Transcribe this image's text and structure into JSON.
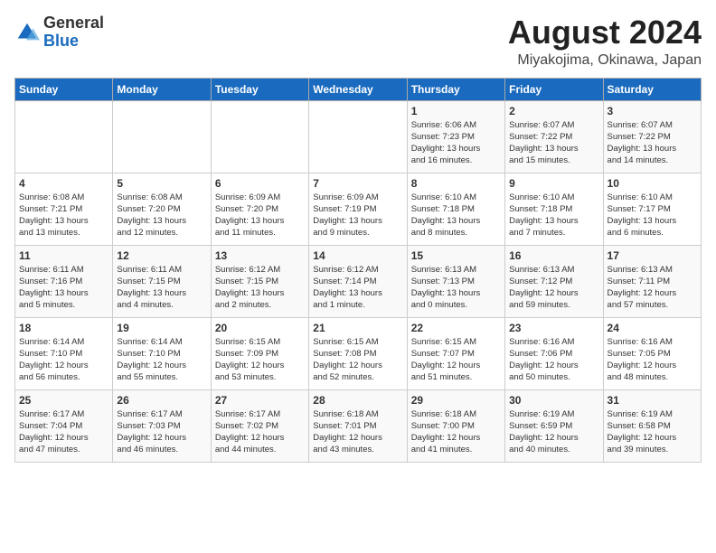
{
  "logo": {
    "general": "General",
    "blue": "Blue"
  },
  "title": "August 2024",
  "subtitle": "Miyakojima, Okinawa, Japan",
  "days_of_week": [
    "Sunday",
    "Monday",
    "Tuesday",
    "Wednesday",
    "Thursday",
    "Friday",
    "Saturday"
  ],
  "weeks": [
    [
      {
        "day": "",
        "details": ""
      },
      {
        "day": "",
        "details": ""
      },
      {
        "day": "",
        "details": ""
      },
      {
        "day": "",
        "details": ""
      },
      {
        "day": "1",
        "details": "Sunrise: 6:06 AM\nSunset: 7:23 PM\nDaylight: 13 hours\nand 16 minutes."
      },
      {
        "day": "2",
        "details": "Sunrise: 6:07 AM\nSunset: 7:22 PM\nDaylight: 13 hours\nand 15 minutes."
      },
      {
        "day": "3",
        "details": "Sunrise: 6:07 AM\nSunset: 7:22 PM\nDaylight: 13 hours\nand 14 minutes."
      }
    ],
    [
      {
        "day": "4",
        "details": "Sunrise: 6:08 AM\nSunset: 7:21 PM\nDaylight: 13 hours\nand 13 minutes."
      },
      {
        "day": "5",
        "details": "Sunrise: 6:08 AM\nSunset: 7:20 PM\nDaylight: 13 hours\nand 12 minutes."
      },
      {
        "day": "6",
        "details": "Sunrise: 6:09 AM\nSunset: 7:20 PM\nDaylight: 13 hours\nand 11 minutes."
      },
      {
        "day": "7",
        "details": "Sunrise: 6:09 AM\nSunset: 7:19 PM\nDaylight: 13 hours\nand 9 minutes."
      },
      {
        "day": "8",
        "details": "Sunrise: 6:10 AM\nSunset: 7:18 PM\nDaylight: 13 hours\nand 8 minutes."
      },
      {
        "day": "9",
        "details": "Sunrise: 6:10 AM\nSunset: 7:18 PM\nDaylight: 13 hours\nand 7 minutes."
      },
      {
        "day": "10",
        "details": "Sunrise: 6:10 AM\nSunset: 7:17 PM\nDaylight: 13 hours\nand 6 minutes."
      }
    ],
    [
      {
        "day": "11",
        "details": "Sunrise: 6:11 AM\nSunset: 7:16 PM\nDaylight: 13 hours\nand 5 minutes."
      },
      {
        "day": "12",
        "details": "Sunrise: 6:11 AM\nSunset: 7:15 PM\nDaylight: 13 hours\nand 4 minutes."
      },
      {
        "day": "13",
        "details": "Sunrise: 6:12 AM\nSunset: 7:15 PM\nDaylight: 13 hours\nand 2 minutes."
      },
      {
        "day": "14",
        "details": "Sunrise: 6:12 AM\nSunset: 7:14 PM\nDaylight: 13 hours\nand 1 minute."
      },
      {
        "day": "15",
        "details": "Sunrise: 6:13 AM\nSunset: 7:13 PM\nDaylight: 13 hours\nand 0 minutes."
      },
      {
        "day": "16",
        "details": "Sunrise: 6:13 AM\nSunset: 7:12 PM\nDaylight: 12 hours\nand 59 minutes."
      },
      {
        "day": "17",
        "details": "Sunrise: 6:13 AM\nSunset: 7:11 PM\nDaylight: 12 hours\nand 57 minutes."
      }
    ],
    [
      {
        "day": "18",
        "details": "Sunrise: 6:14 AM\nSunset: 7:10 PM\nDaylight: 12 hours\nand 56 minutes."
      },
      {
        "day": "19",
        "details": "Sunrise: 6:14 AM\nSunset: 7:10 PM\nDaylight: 12 hours\nand 55 minutes."
      },
      {
        "day": "20",
        "details": "Sunrise: 6:15 AM\nSunset: 7:09 PM\nDaylight: 12 hours\nand 53 minutes."
      },
      {
        "day": "21",
        "details": "Sunrise: 6:15 AM\nSunset: 7:08 PM\nDaylight: 12 hours\nand 52 minutes."
      },
      {
        "day": "22",
        "details": "Sunrise: 6:15 AM\nSunset: 7:07 PM\nDaylight: 12 hours\nand 51 minutes."
      },
      {
        "day": "23",
        "details": "Sunrise: 6:16 AM\nSunset: 7:06 PM\nDaylight: 12 hours\nand 50 minutes."
      },
      {
        "day": "24",
        "details": "Sunrise: 6:16 AM\nSunset: 7:05 PM\nDaylight: 12 hours\nand 48 minutes."
      }
    ],
    [
      {
        "day": "25",
        "details": "Sunrise: 6:17 AM\nSunset: 7:04 PM\nDaylight: 12 hours\nand 47 minutes."
      },
      {
        "day": "26",
        "details": "Sunrise: 6:17 AM\nSunset: 7:03 PM\nDaylight: 12 hours\nand 46 minutes."
      },
      {
        "day": "27",
        "details": "Sunrise: 6:17 AM\nSunset: 7:02 PM\nDaylight: 12 hours\nand 44 minutes."
      },
      {
        "day": "28",
        "details": "Sunrise: 6:18 AM\nSunset: 7:01 PM\nDaylight: 12 hours\nand 43 minutes."
      },
      {
        "day": "29",
        "details": "Sunrise: 6:18 AM\nSunset: 7:00 PM\nDaylight: 12 hours\nand 41 minutes."
      },
      {
        "day": "30",
        "details": "Sunrise: 6:19 AM\nSunset: 6:59 PM\nDaylight: 12 hours\nand 40 minutes."
      },
      {
        "day": "31",
        "details": "Sunrise: 6:19 AM\nSunset: 6:58 PM\nDaylight: 12 hours\nand 39 minutes."
      }
    ]
  ]
}
